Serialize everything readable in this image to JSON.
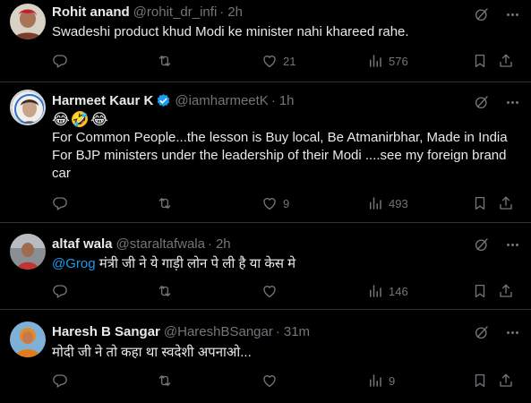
{
  "tweets": [
    {
      "name": "Rohit anand",
      "handle": "@rohit_dr_infi",
      "time": "2h",
      "text": "Swadeshi product khud Modi ke minister nahi khareed rahe.",
      "replies": "",
      "retweets": "",
      "likes": "21",
      "views": "576"
    },
    {
      "name": "Harmeet Kaur K",
      "handle": "@iamharmeetK",
      "time": "1h",
      "verified": true,
      "emojis": "😂🤣😂",
      "text_lines": [
        "For Common People...the lesson is Buy local, Be Atmanirbhar, Made in India",
        "For BJP ministers under the leadership of their Modi ....see my foreign brand",
        "car"
      ],
      "replies": "",
      "retweets": "",
      "likes": "9",
      "views": "493"
    },
    {
      "name": "altaf wala",
      "handle": "@staraltafwala",
      "time": "2h",
      "mention": "@Grog",
      "text": " मंत्री जी ने ये गाड़ी लोन पे ली है या केस मे",
      "replies": "",
      "retweets": "",
      "likes": "",
      "views": "146"
    },
    {
      "name": "Haresh B Sangar",
      "handle": "@HareshBSangar",
      "time": "31m",
      "text": "मोदी जी ने तो कहा था स्वदेशी अपनाओ...",
      "replies": "",
      "retweets": "",
      "likes": "",
      "views": "9"
    }
  ],
  "separator": "·",
  "colors": {
    "background": "#000000",
    "text": "#e7e9ea",
    "muted": "#71767b",
    "link": "#1d9bf0",
    "border": "#2f3336",
    "verified": "#1d9bf0"
  }
}
